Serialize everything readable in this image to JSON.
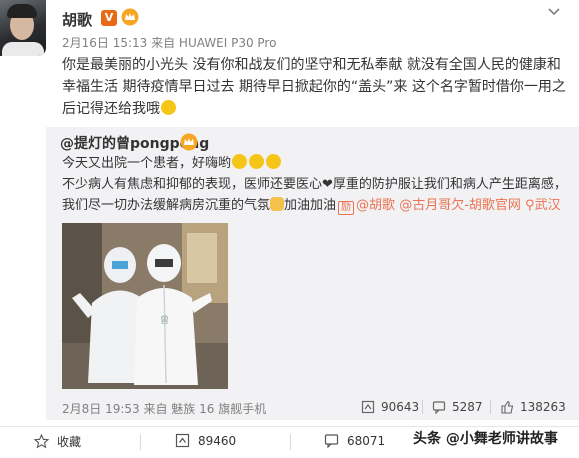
{
  "post": {
    "author": "胡歌",
    "verified_badge_text": "V",
    "meta": "2月16日 15:13 来自 HUAWEI P30 Pro",
    "text": "你是最美丽的小光头 没有你和战友们的坚守和无私奉献 就没有全国人民的健康和幸福生活 期待疫情早日过去 期待早日掀起你的“盖头”来 这个名字暂时借你一用之后记得还给我哦"
  },
  "repost": {
    "author": "@提灯的曾pongpong",
    "line1": "今天又出院一个患者，好嗨哟",
    "body": "不少病人有焦虑和抑郁的表现，医师还要医心",
    "body2": "厚重的防护服让我们和病人产生距离感，我们尽一切办法缓解病房沉重的气氛",
    "cheer": "加油加油",
    "ad_icon": "励",
    "mention1": "@胡歌",
    "mention2": "@古月哥欠-胡歌官网",
    "location": "武汉",
    "meta": "2月8日 19:53 来自 魅族 16 旗舰手机",
    "reposts": "90643",
    "comments": "5287",
    "likes": "138263"
  },
  "footer": {
    "favorite_label": "收藏",
    "reposts": "89460",
    "comments": "68071"
  },
  "watermark": "头条 @小舞老师讲故事",
  "colors": {
    "link": "#eb7350",
    "repost_bg": "#f2f2f5",
    "verified": "#e96a16"
  },
  "icons": [
    "crown-icon",
    "caret-down-icon",
    "repost-icon",
    "comment-icon",
    "like-icon",
    "star-icon",
    "location-pin-icon"
  ]
}
